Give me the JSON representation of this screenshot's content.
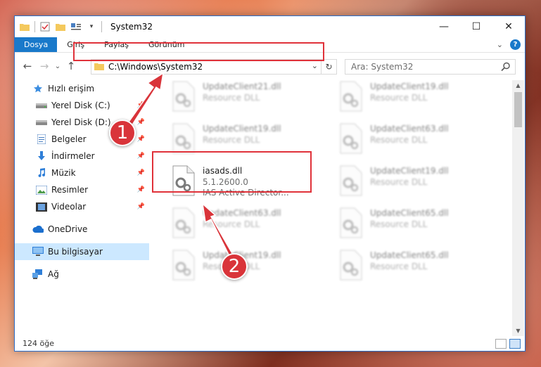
{
  "window": {
    "title": "System32",
    "controls": {
      "minimize": "—",
      "maximize": "☐",
      "close": "✕"
    }
  },
  "ribbon": {
    "tabs": [
      "Dosya",
      "Giriş",
      "Paylaş",
      "Görünüm"
    ],
    "expand": "⌄",
    "help": "?"
  },
  "nav": {
    "back": "←",
    "forward": "→",
    "recent": "⌄",
    "up": "↑",
    "address": "C:\\Windows\\System32",
    "dropdown": "⌄",
    "refresh": "↻",
    "search_placeholder": "Ara: System32"
  },
  "sidebar": {
    "items": [
      {
        "label": "Hızlı erişim",
        "icon": "star-icon"
      },
      {
        "label": "Yerel Disk (C:)",
        "icon": "drive-icon",
        "pinned": true
      },
      {
        "label": "Yerel Disk (D:)",
        "icon": "drive-icon",
        "pinned": true
      },
      {
        "label": "Belgeler",
        "icon": "documents-icon",
        "pinned": true
      },
      {
        "label": "İndirmeler",
        "icon": "downloads-icon",
        "pinned": true
      },
      {
        "label": "Müzik",
        "icon": "music-icon",
        "pinned": true
      },
      {
        "label": "Resimler",
        "icon": "pictures-icon",
        "pinned": true
      },
      {
        "label": "Videolar",
        "icon": "videos-icon",
        "pinned": true
      },
      {
        "label": "OneDrive",
        "icon": "cloud-icon"
      },
      {
        "label": "Bu bilgisayar",
        "icon": "computer-icon",
        "selected": true
      },
      {
        "label": "Ağ",
        "icon": "network-icon"
      }
    ],
    "pin_glyph": "📌"
  },
  "files": [
    {
      "name": "UpdateClient21.dll",
      "sub1": "Resource DLL",
      "sub2": "",
      "blurred": true
    },
    {
      "name": "UpdateClient19.dll",
      "sub1": "Resource DLL",
      "sub2": "",
      "blurred": true
    },
    {
      "name": "UpdateClient19.dll",
      "sub1": "Resource DLL",
      "sub2": "",
      "blurred": true
    },
    {
      "name": "UpdateClient63.dll",
      "sub1": "Resource DLL",
      "sub2": "",
      "blurred": true
    },
    {
      "name": "iasads.dll",
      "sub1": "5.1.2600.0",
      "sub2": "IAS Active Director...",
      "blurred": false
    },
    {
      "name": "UpdateClient19.dll",
      "sub1": "Resource DLL",
      "sub2": "",
      "blurred": true
    },
    {
      "name": "UpdateClient63.dll",
      "sub1": "Resource DLL",
      "sub2": "",
      "blurred": true
    },
    {
      "name": "UpdateClient65.dll",
      "sub1": "Resource DLL",
      "sub2": "",
      "blurred": true
    },
    {
      "name": "UpdateClient19.dll",
      "sub1": "Resource DLL",
      "sub2": "",
      "blurred": true
    },
    {
      "name": "UpdateClient65.dll",
      "sub1": "Resource DLL",
      "sub2": "",
      "blurred": true
    }
  ],
  "status": {
    "count": "124 öğe"
  },
  "annotations": {
    "step1": "1",
    "step2": "2",
    "color": "#d9343a"
  }
}
